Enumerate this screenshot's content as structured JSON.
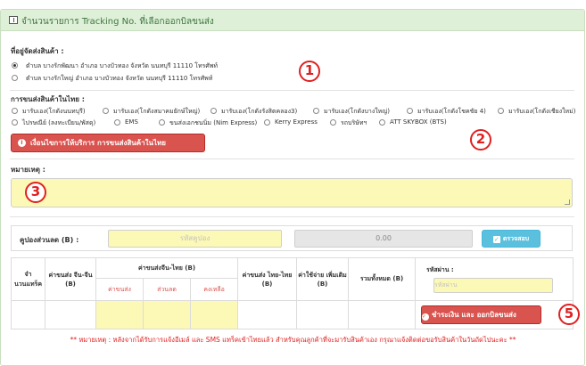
{
  "header": {
    "title": "จำนวนรายการ Tracking No. ที่เลือกออกบิลขนส่ง"
  },
  "address": {
    "label": "ที่อยู่จัดส่งสินค้า :",
    "options": [
      {
        "text": "ตำบล บางรักพัฒนา อำเภอ บางบัวทอง จังหวัด นนทบุรี 11110 โทรศัพท์",
        "selected": true
      },
      {
        "text": "ตำบล บางรักใหญ่ อำเภอ บางบัวทอง จังหวัด นนทบุรี 11110 โทรศัพท์",
        "selected": false
      }
    ]
  },
  "shipping": {
    "label": "การขนส่งสินค้าในไทย :",
    "options": [
      "มารับเอง(โกดังนนทบุรี)",
      "มารับเอง(โกดังสมาคมยักษ์ใหญ่)",
      "มารับเอง(โกดังรังสิตคลอง3)",
      "มารับเอง(โกดังบางใหญ่)",
      "มารับเอง(โกดังโชคชัย 4)",
      "มารับเอง(โกดังเชียงใหม่)",
      "ไปรษณีย์ (ลงทะเบียน/พัสดุ)",
      "EMS",
      "ขนส่งเอกชนนิ่ม (Nim Express)",
      "Kerry Express",
      "รถบริษัทฯ",
      "ATT SKYBOX (BTS)"
    ],
    "conditions_button": "เงื่อนไขการให้บริการ การขนส่งสินค้าในไทย"
  },
  "remark": {
    "label": "หมายเหตุ :"
  },
  "coupon": {
    "label": "คูปองส่วนลด (B) :",
    "placeholder": "รหัสคูปอง",
    "amount": "0.00",
    "check_button": "ตรวจสอบ"
  },
  "summary": {
    "headers": {
      "count": "จำนวนแทร็ค",
      "china_shipping": "ค่าขนส่ง จีน-จีน (B)",
      "china_thai": "ค่าขนส่งจีน-ไทย (B)",
      "sub_shipping": "ค่าขนส่ง",
      "sub_discount": "ส่วนลด",
      "sub_remaining": "คงเหลือ",
      "thai_shipping": "ค่าขนส่ง ไทย-ไทย (B)",
      "extra": "ค่าใช้จ่าย เพิ่มเติม (B)",
      "total": "รวมทั้งหมด (B)",
      "password": "รหัสผ่าน :"
    },
    "password_placeholder": "รหัสผ่าน",
    "pay_button": "ชำระเงิน และ ออกบิลขนส่ง"
  },
  "note": "** หมายเหตุ : หลังจากได้รับการแจ้งอีเมล์ และ SMS แทร็คเข้าไทยแล้ว สำหรับคุณลูกค้าที่จะมารับสินค้าเอง กรุณาแจ้งติดต่อขอรับสินค้าในวันถัดไปนะคะ **",
  "annotations": [
    "1",
    "2",
    "3",
    "5"
  ],
  "colors": {
    "header_bg": "#dff0d8",
    "danger": "#d9534f",
    "info": "#5bc0de",
    "input_yellow": "#fcf8b5",
    "annotation": "#e02020"
  }
}
